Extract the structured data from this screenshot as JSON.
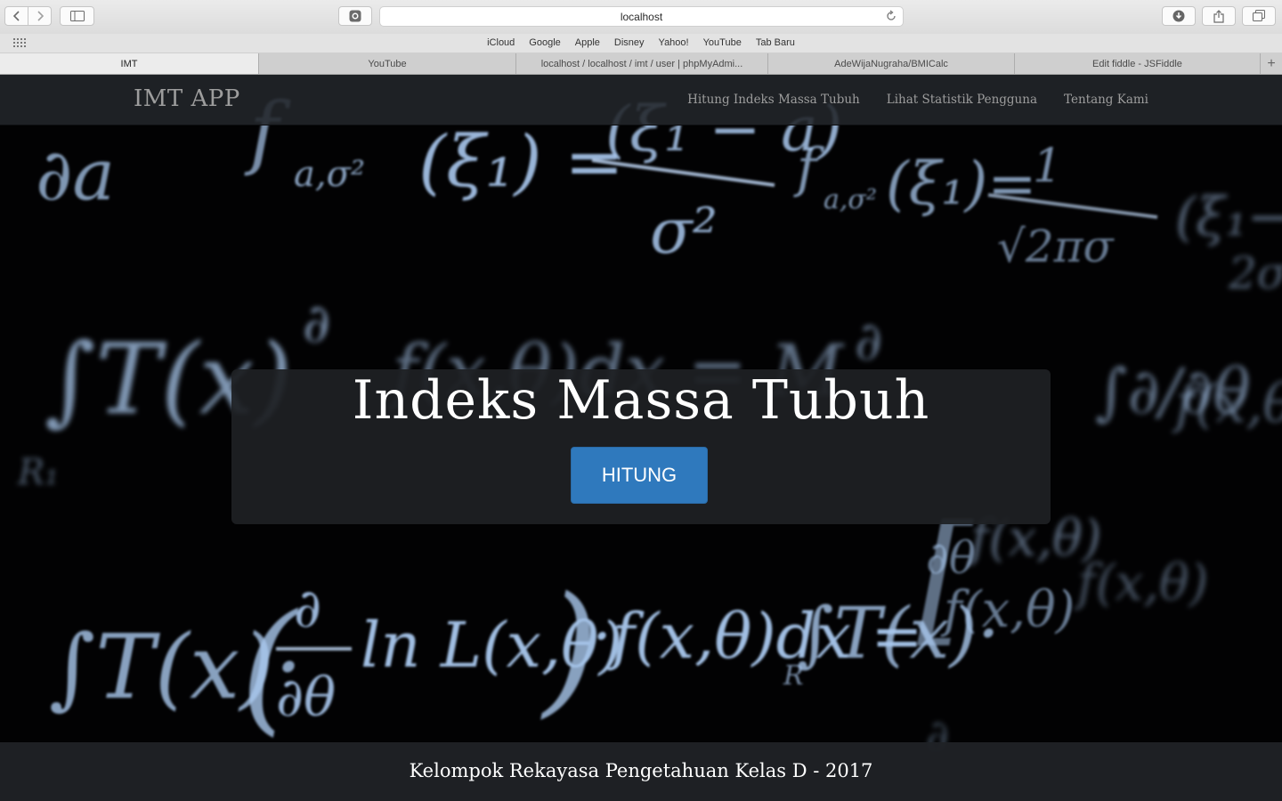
{
  "browser": {
    "address": "localhost",
    "favorites": [
      "iCloud",
      "Google",
      "Apple",
      "Disney",
      "Yahoo!",
      "YouTube",
      "Tab Baru"
    ],
    "tabs": [
      "IMT",
      "YouTube",
      "localhost / localhost / imt / user | phpMyAdmi...",
      "AdeWijaNugraha/BMICalc",
      "Edit fiddle - JSFiddle"
    ],
    "active_tab": 0,
    "add_tab": "+"
  },
  "navbar": {
    "brand": "IMT APP",
    "links": [
      "Hitung Indeks Massa Tubuh",
      "Lihat Statistik Pengguna",
      "Tentang Kami"
    ]
  },
  "hero": {
    "title": "Indeks Massa Tubuh",
    "button": "HITUNG"
  },
  "footer": {
    "text": "Kelompok Rekayasa Pengetahuan Kelas D - 2017"
  },
  "background": {
    "description_icon": "math-formula-chalkboard"
  }
}
